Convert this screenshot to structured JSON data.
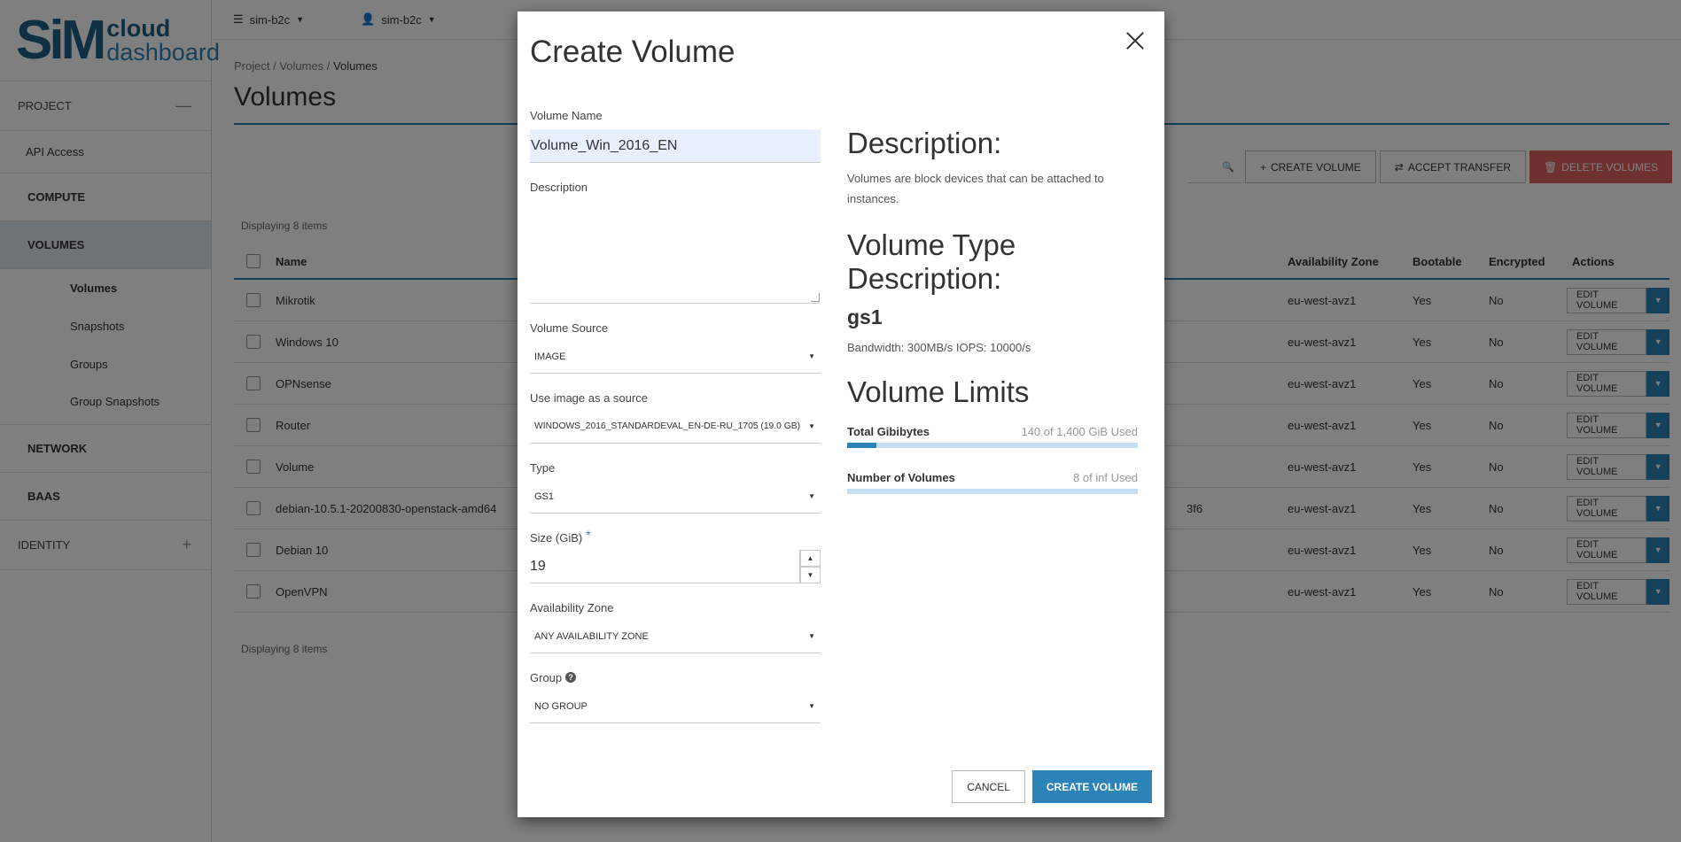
{
  "logo": {
    "sim": "SiM",
    "cloud": "cloud",
    "dashboard": "dashboard"
  },
  "topbar": {
    "domain": "sim-b2c",
    "user": "sim-b2c"
  },
  "sidebar": {
    "project": "PROJECT",
    "api_access": "API Access",
    "compute": "COMPUTE",
    "volumes": "VOLUMES",
    "volumes_items": [
      "Volumes",
      "Snapshots",
      "Groups",
      "Group Snapshots"
    ],
    "network": "NETWORK",
    "baas": "BAAS",
    "identity": "IDENTITY"
  },
  "breadcrumb": {
    "project": "Project",
    "volumes": "Volumes",
    "current": "Volumes"
  },
  "page_title": "Volumes",
  "toolbar": {
    "create_volume": "CREATE VOLUME",
    "accept_transfer": "ACCEPT TRANSFER",
    "delete_volumes": "DELETE VOLUMES"
  },
  "table": {
    "display_count": "Displaying 8 items",
    "headers": {
      "name": "Name",
      "az": "Availability Zone",
      "bootable": "Bootable",
      "encrypted": "Encrypted",
      "actions": "Actions"
    },
    "edit_label": "EDIT VOLUME",
    "rows": [
      {
        "name": "Mikrotik",
        "extra": "",
        "az": "eu-west-avz1",
        "bootable": "Yes",
        "encrypted": "No"
      },
      {
        "name": "Windows 10",
        "extra": "",
        "az": "eu-west-avz1",
        "bootable": "Yes",
        "encrypted": "No"
      },
      {
        "name": "OPNsense",
        "extra": "",
        "az": "eu-west-avz1",
        "bootable": "Yes",
        "encrypted": "No"
      },
      {
        "name": "Router",
        "extra": "",
        "az": "eu-west-avz1",
        "bootable": "Yes",
        "encrypted": "No"
      },
      {
        "name": "Volume",
        "extra": "",
        "az": "eu-west-avz1",
        "bootable": "Yes",
        "encrypted": "No"
      },
      {
        "name": "debian-10.5.1-20200830-openstack-amd64",
        "extra": "3f6",
        "az": "eu-west-avz1",
        "bootable": "Yes",
        "encrypted": "No"
      },
      {
        "name": "Debian 10",
        "extra": "",
        "az": "eu-west-avz1",
        "bootable": "Yes",
        "encrypted": "No"
      },
      {
        "name": "OpenVPN",
        "extra": "",
        "az": "eu-west-avz1",
        "bootable": "Yes",
        "encrypted": "No"
      }
    ]
  },
  "modal": {
    "title": "Create Volume",
    "form": {
      "volume_name_label": "Volume Name",
      "volume_name_value": "Volume_Win_2016_EN",
      "description_label": "Description",
      "volume_source_label": "Volume Source",
      "volume_source_value": "IMAGE",
      "image_source_label": "Use image as a source",
      "image_source_value": "WINDOWS_2016_STANDARDEVAL_EN-DE-RU_1705 (19.0 GB)",
      "type_label": "Type",
      "type_value": "GS1",
      "size_label": "Size (GiB)",
      "size_value": "19",
      "az_label": "Availability Zone",
      "az_value": "ANY AVAILABILITY ZONE",
      "group_label": "Group",
      "group_value": "NO GROUP"
    },
    "description": {
      "heading": "Description:",
      "text": "Volumes are block devices that can be attached to instances.",
      "type_heading": "Volume Type Description:",
      "type_name": "gs1",
      "bandwidth": "Bandwidth: 300MB/s IOPS: 10000/s",
      "limits_heading": "Volume Limits",
      "limits": [
        {
          "name": "Total Gibibytes",
          "used": "140 of 1,400 GiB Used",
          "fraction": 0.1
        },
        {
          "name": "Number of Volumes",
          "used": "8 of inf Used",
          "fraction": 0
        }
      ]
    },
    "buttons": {
      "cancel": "CANCEL",
      "create": "CREATE VOLUME"
    }
  },
  "colors": {
    "accent": "#2b83b7",
    "brand": "#1e5f86",
    "danger": "#d9534f"
  }
}
